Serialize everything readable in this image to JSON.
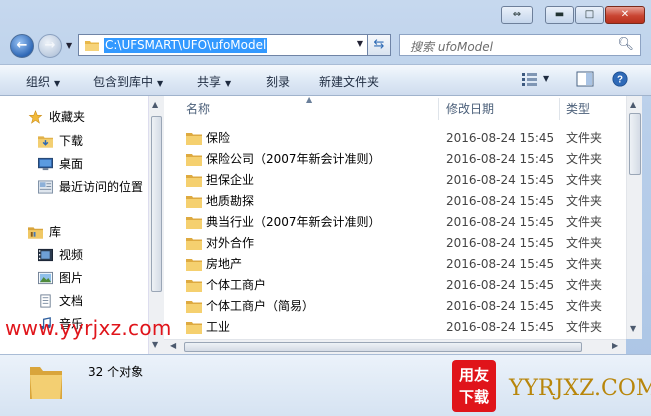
{
  "window": {
    "controls": {
      "restore_label": "⇔",
      "minimize_label": "▬",
      "maximize_label": "□",
      "close_label": "✕"
    }
  },
  "address_bar": {
    "path": "C:\\UFSMART\\UFO\\ufoModel",
    "search_placeholder": "搜索 ufoModel"
  },
  "toolbar": {
    "organize": "组织",
    "include_in_library": "包含到库中",
    "share": "共享",
    "burn": "刻录",
    "new_folder": "新建文件夹"
  },
  "nav_pane": {
    "favorites": {
      "label": "收藏夹",
      "items": [
        {
          "label": "下载",
          "icon": "download-folder-icon"
        },
        {
          "label": "桌面",
          "icon": "desktop-icon"
        },
        {
          "label": "最近访问的位置",
          "icon": "recent-places-icon"
        }
      ]
    },
    "libraries": {
      "label": "库",
      "items": [
        {
          "label": "视频",
          "icon": "video-library-icon"
        },
        {
          "label": "图片",
          "icon": "picture-library-icon"
        },
        {
          "label": "文档",
          "icon": "document-library-icon"
        },
        {
          "label": "音乐",
          "icon": "music-library-icon"
        }
      ]
    }
  },
  "file_list": {
    "columns": {
      "name": "名称",
      "date_modified": "修改日期",
      "type": "类型"
    },
    "rows": [
      {
        "name": "保险",
        "date": "2016-08-24 15:45",
        "type": "文件夹"
      },
      {
        "name": "保险公司（2007年新会计准则）",
        "date": "2016-08-24 15:45",
        "type": "文件夹"
      },
      {
        "name": "担保企业",
        "date": "2016-08-24 15:45",
        "type": "文件夹"
      },
      {
        "name": "地质勘探",
        "date": "2016-08-24 15:45",
        "type": "文件夹"
      },
      {
        "name": "典当行业（2007年新会计准则）",
        "date": "2016-08-24 15:45",
        "type": "文件夹"
      },
      {
        "name": "对外合作",
        "date": "2016-08-24 15:45",
        "type": "文件夹"
      },
      {
        "name": "房地产",
        "date": "2016-08-24 15:45",
        "type": "文件夹"
      },
      {
        "name": "个体工商户",
        "date": "2016-08-24 15:45",
        "type": "文件夹"
      },
      {
        "name": "个体工商户（简易）",
        "date": "2016-08-24 15:45",
        "type": "文件夹"
      },
      {
        "name": "工业",
        "date": "2016-08-24 15:45",
        "type": "文件夹"
      }
    ]
  },
  "status_bar": {
    "item_count": "32 个对象"
  },
  "watermark": {
    "url": "www.yyrjxz.com",
    "logo_line1": "用友",
    "logo_line2": "下载",
    "logo_text": "YYRJXZ.COM"
  },
  "colors": {
    "selection": "#3399ff",
    "folder": "#f2c75c",
    "watermark_red": "#e0141a",
    "logo_gold": "#b8860b"
  }
}
